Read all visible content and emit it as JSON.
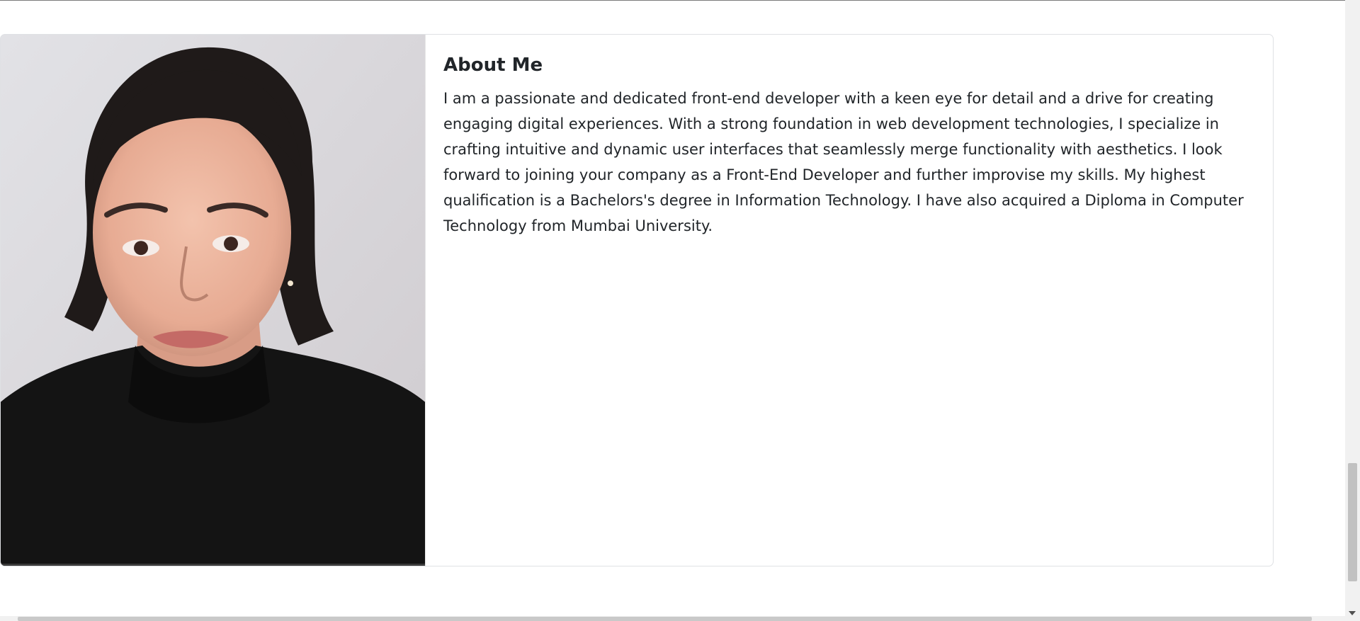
{
  "about": {
    "title": "About Me",
    "text": "I am a passionate and dedicated front-end developer with a keen eye for detail and a drive for creating engaging digital experiences. With a strong foundation in web development technologies, I specialize in crafting intuitive and dynamic user interfaces that seamlessly merge functionality with aesthetics. I look forward to joining your company as a Front-End Developer and further improvise my skills. My highest qualification is a Bachelors's degree in Information Technology. I have also acquired a Diploma in Computer Technology from Mumbai University."
  },
  "colors": {
    "text": "#212529",
    "card_border": "#dfe1e4",
    "scrollbar_track": "#f1f1f1",
    "scrollbar_thumb": "#c1c1c1"
  }
}
